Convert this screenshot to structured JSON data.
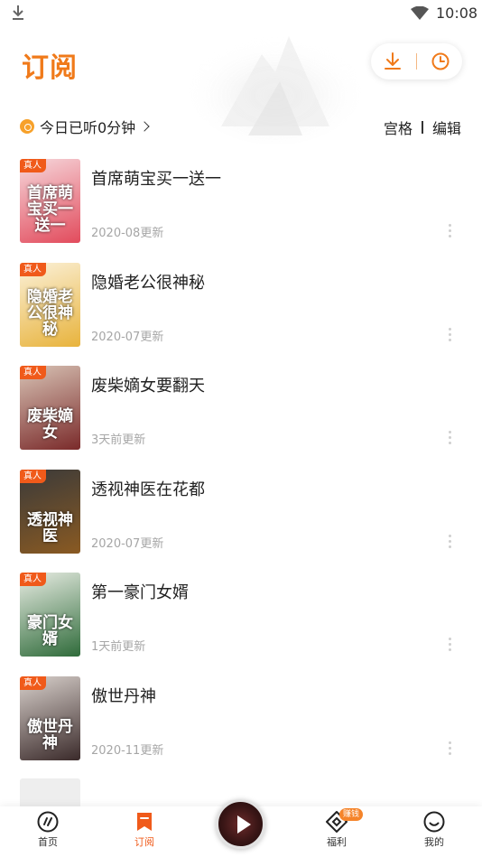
{
  "status_bar": {
    "time": "10:08"
  },
  "header": {
    "title": "订阅"
  },
  "listen": {
    "text": "今日已听0分钟"
  },
  "view_actions": {
    "grid": "宫格",
    "edit": "编辑"
  },
  "books": [
    {
      "title": "首席萌宝买一送一",
      "updated": "2020-08更新",
      "tag": "真人",
      "cover_text": "首席萌宝买一送一",
      "cover_colors": [
        "#f6d8dc",
        "#e24b5c"
      ]
    },
    {
      "title": "隐婚老公很神秘",
      "updated": "2020-07更新",
      "tag": "真人",
      "cover_text": "隐婚老公很神秘",
      "cover_colors": [
        "#fbf1d9",
        "#e8b33c"
      ]
    },
    {
      "title": "废柴嫡女要翻天",
      "updated": "3天前更新",
      "tag": "真人",
      "cover_text": "废柴嫡女",
      "cover_colors": [
        "#d8c3b5",
        "#7a2a2a"
      ]
    },
    {
      "title": "透视神医在花都",
      "updated": "2020-07更新",
      "tag": "真人",
      "cover_text": "透视神医",
      "cover_colors": [
        "#3a3a3a",
        "#8a5a22"
      ]
    },
    {
      "title": "第一豪门女婿",
      "updated": "1天前更新",
      "tag": "真人",
      "cover_text": "豪门女婿",
      "cover_colors": [
        "#e9ede4",
        "#2f6b3a"
      ]
    },
    {
      "title": "傲世丹神",
      "updated": "2020-11更新",
      "tag": "真人",
      "cover_text": "傲世丹神",
      "cover_colors": [
        "#d9d1cc",
        "#3a2a2a"
      ]
    }
  ],
  "nav": [
    {
      "label": "首页",
      "icon": "home-dial-icon"
    },
    {
      "label": "订阅",
      "icon": "bookmark-icon"
    },
    {
      "label": "福利",
      "icon": "diamond-icon",
      "badge": "赚钱"
    },
    {
      "label": "我的",
      "icon": "smile-icon"
    }
  ],
  "colors": {
    "accent": "#f07a1a",
    "tag": "#f05a1a",
    "meta_text": "#a6a6a6"
  }
}
